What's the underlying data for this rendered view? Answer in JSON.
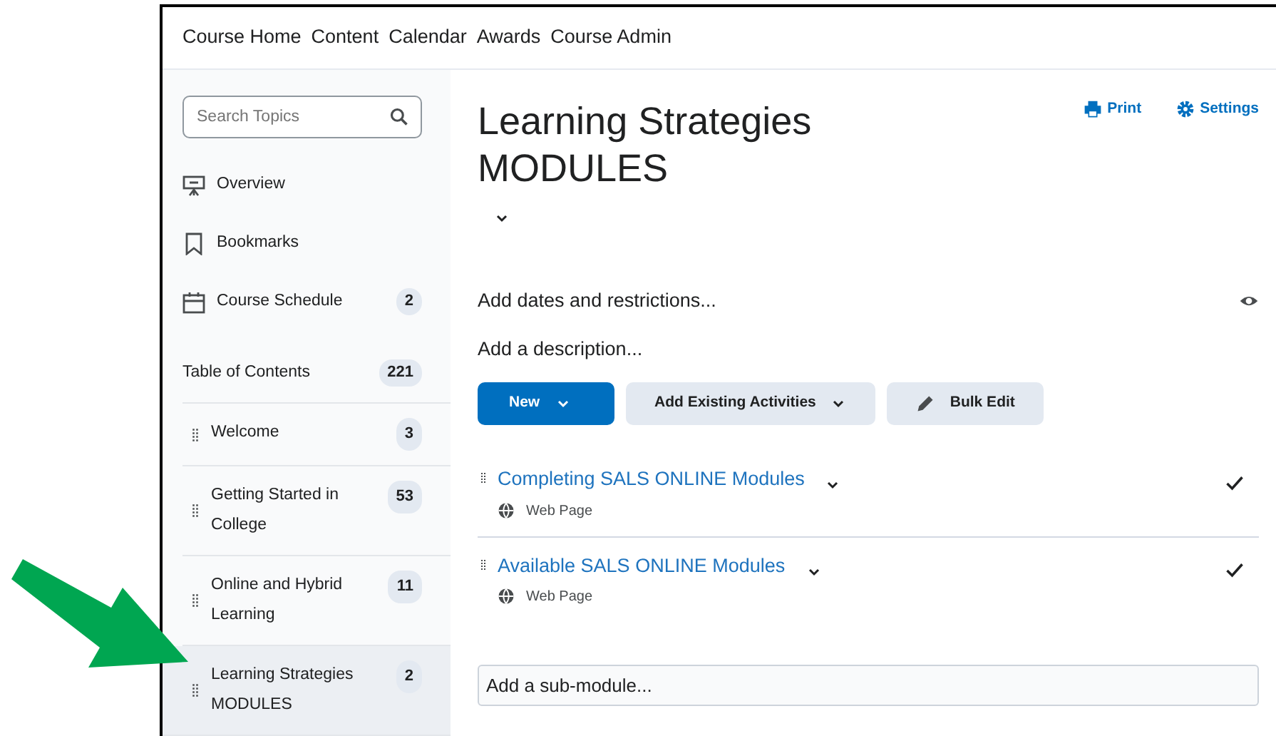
{
  "navbar": {
    "items": [
      "Course Home",
      "Content",
      "Calendar",
      "Awards",
      "Course Admin"
    ]
  },
  "sidebar": {
    "search": {
      "placeholder": "Search Topics"
    },
    "tools": [
      {
        "kind": "overview",
        "label": "Overview"
      },
      {
        "kind": "bookmarks",
        "label": "Bookmarks"
      },
      {
        "kind": "schedule",
        "label": "Course Schedule",
        "count": "2"
      }
    ],
    "toc": {
      "label": "Table of Contents",
      "count": "221"
    },
    "modules": [
      {
        "label": "Welcome",
        "count": "3",
        "selected": false
      },
      {
        "label": "Getting Started in College",
        "count": "53",
        "selected": false
      },
      {
        "label": "Online and Hybrid Learning",
        "count": "11",
        "selected": false
      },
      {
        "label": "Learning Strategies MODULES",
        "count": "2",
        "selected": true
      }
    ]
  },
  "module": {
    "title": "Learning Strategies MODULES",
    "actions": [
      {
        "kind": "print",
        "label": "Print"
      },
      {
        "kind": "settings",
        "label": "Settings"
      }
    ],
    "dates_link": "Add dates and restrictions...",
    "description_link": "Add a description...",
    "buttons": [
      {
        "kind": "primary",
        "label": "New",
        "dropdown": true
      },
      {
        "kind": "secondary",
        "label": "Add Existing Activities",
        "dropdown": true
      },
      {
        "kind": "bulk-edit",
        "label": "Bulk Edit",
        "dropdown": false
      }
    ],
    "topics": [
      {
        "title": "Completing SALS ONLINE Modules",
        "type": "Web Page",
        "completed": true
      },
      {
        "title": "Available SALS ONLINE Modules",
        "type": "Web Page",
        "completed": true
      }
    ],
    "submodule": {
      "placeholder": "Add a sub-module..."
    }
  }
}
